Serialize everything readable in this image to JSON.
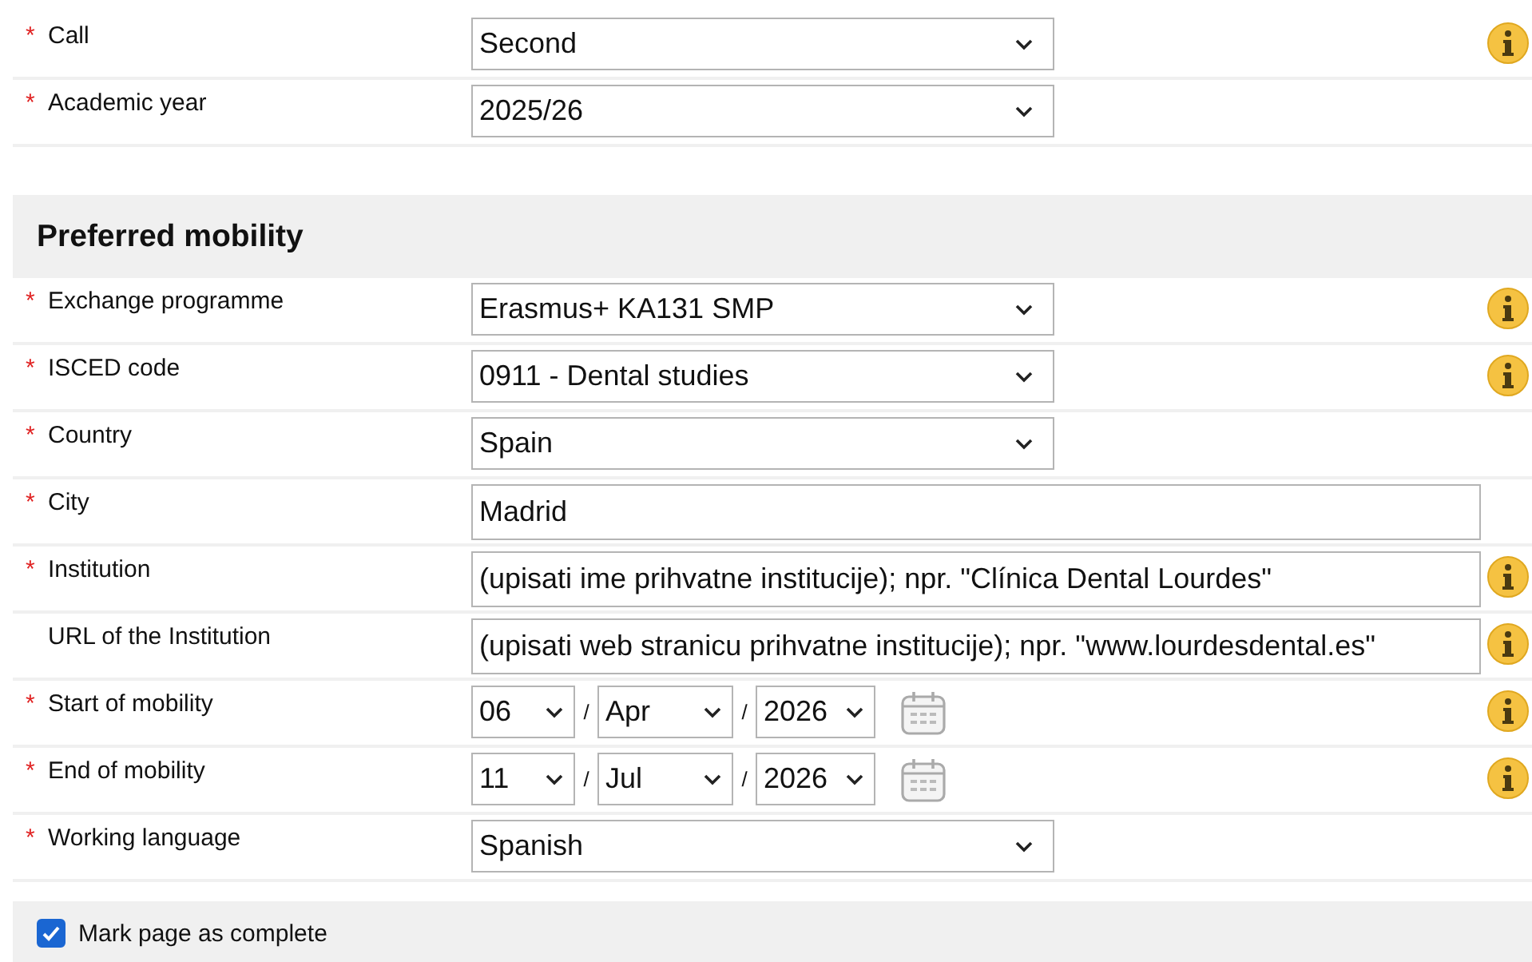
{
  "general": [
    {
      "kind": "select",
      "marker": "*",
      "label": "Call",
      "value": "Second",
      "info": true
    },
    {
      "kind": "select",
      "marker": "*",
      "label": "Academic year",
      "value": "2025/26",
      "info": false
    }
  ],
  "section": {
    "title": "Preferred mobility",
    "rows": [
      {
        "kind": "select",
        "marker": "*",
        "label": "Exchange programme",
        "value": "Erasmus+ KA131 SMP",
        "info": true
      },
      {
        "kind": "select",
        "marker": "*",
        "label": "ISCED code",
        "value": "0911 - Dental studies",
        "info": true
      },
      {
        "kind": "select",
        "marker": "*",
        "label": "Country",
        "value": "Spain",
        "info": false
      },
      {
        "kind": "text",
        "marker": "*",
        "label": "City",
        "value": "Madrid",
        "info": false
      },
      {
        "kind": "text",
        "marker": "*",
        "label": "Institution",
        "value": "(upisati ime prihvatne institucije); npr. \"Clínica Dental Lourdes\"",
        "info": true
      },
      {
        "kind": "text",
        "label": "URL of the Institution",
        "value": "(upisati web stranicu prihvatne institucije); npr. \"www.lourdesdental.es\"",
        "info": true
      },
      {
        "kind": "date",
        "marker": "*",
        "label": "Start of mobility",
        "day": "06",
        "month": "Apr",
        "year": "2026",
        "separators": [
          "/",
          "/"
        ],
        "info": true
      },
      {
        "kind": "date",
        "marker": "*",
        "label": "End of mobility",
        "day": "11",
        "month": "Jul",
        "year": "2026",
        "separators": [
          "/",
          "/"
        ],
        "info": true
      },
      {
        "kind": "select",
        "marker": "*",
        "label": "Working language",
        "value": "Spanish",
        "info": false
      }
    ]
  },
  "complete": {
    "label": "Mark page as complete",
    "checked": true
  }
}
